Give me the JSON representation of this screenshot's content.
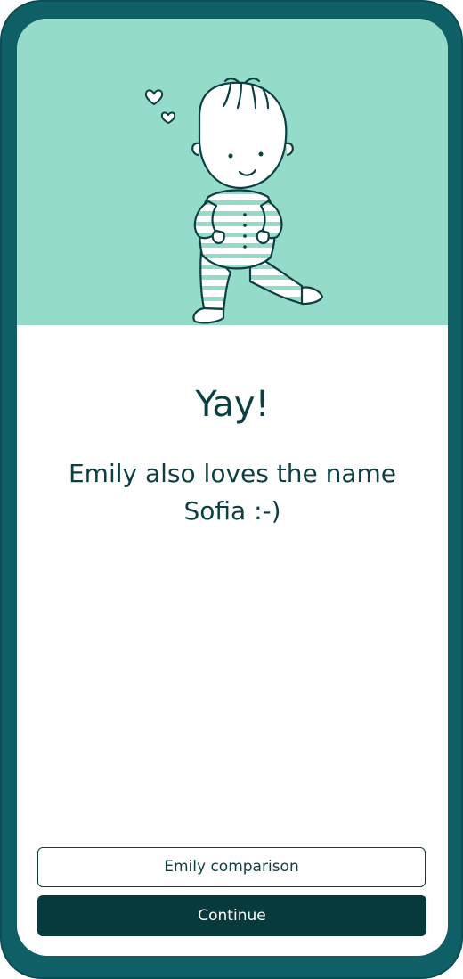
{
  "screen": {
    "title": "Yay!",
    "message": "Emily also loves the name Sofia :-)"
  },
  "actions": {
    "comparison_label": "Emily comparison",
    "continue_label": "Continue"
  },
  "colors": {
    "frame": "#0e5f66",
    "hero_background": "#95dbc9",
    "text": "#0b3f42",
    "primary_button": "#073a3c"
  },
  "illustration": {
    "subject": "baby-illustration",
    "decorations": [
      "heart-icon",
      "heart-icon"
    ]
  }
}
